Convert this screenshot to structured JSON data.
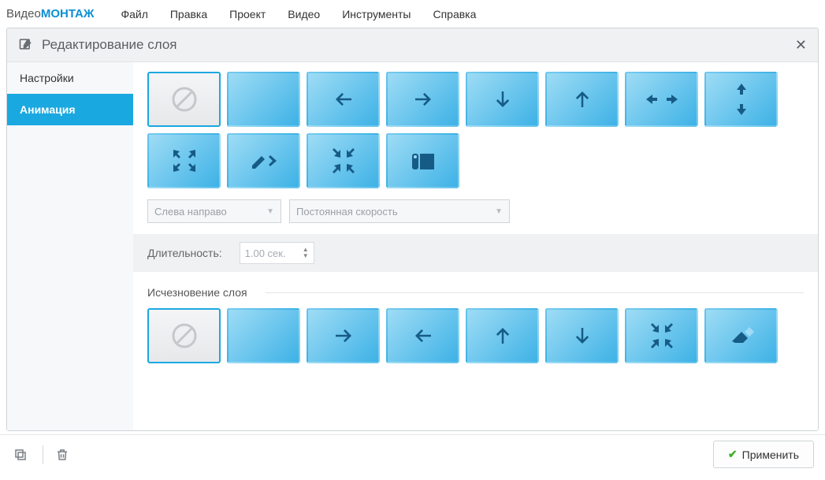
{
  "brand": {
    "part1": "Видео",
    "part2": "МОНТАЖ"
  },
  "menu": {
    "file": "Файл",
    "edit": "Правка",
    "project": "Проект",
    "video": "Видео",
    "tools": "Инструменты",
    "help": "Справка"
  },
  "panel": {
    "title": "Редактирование слоя"
  },
  "sidebar": {
    "settings": "Настройки",
    "animation": "Анимация"
  },
  "appear": {
    "direction": "Слева направо",
    "speed": "Постоянная скорость",
    "durationLabel": "Длительность:",
    "durationValue": "1.00 сек."
  },
  "disappear": {
    "label": "Исчезновение слоя"
  },
  "footer": {
    "apply": "Применить"
  }
}
